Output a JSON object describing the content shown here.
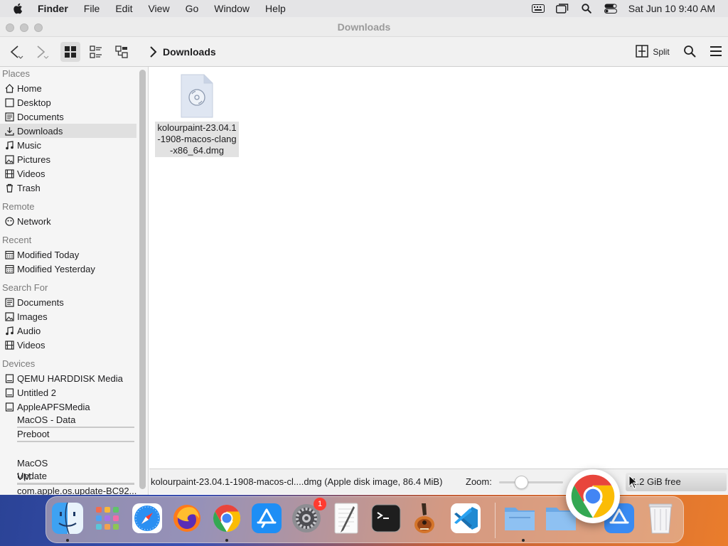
{
  "menubar": {
    "app_name": "Finder",
    "menus": [
      "File",
      "Edit",
      "View",
      "Go",
      "Window",
      "Help"
    ],
    "clock": "Sat Jun 10  9:40 AM",
    "status_icons": [
      "keyboard-icon",
      "window-icon",
      "spotlight-icon",
      "control-center-icon"
    ]
  },
  "window": {
    "title": "Downloads",
    "path": "Downloads",
    "split_label": "Split"
  },
  "sidebar": {
    "places_title": "Places",
    "places": [
      {
        "label": "Home",
        "icon": "home-icon"
      },
      {
        "label": "Desktop",
        "icon": "desktop-icon"
      },
      {
        "label": "Documents",
        "icon": "documents-icon"
      },
      {
        "label": "Downloads",
        "icon": "downloads-icon"
      },
      {
        "label": "Music",
        "icon": "music-icon"
      },
      {
        "label": "Pictures",
        "icon": "pictures-icon"
      },
      {
        "label": "Videos",
        "icon": "videos-icon"
      },
      {
        "label": "Trash",
        "icon": "trash-icon"
      }
    ],
    "remote_title": "Remote",
    "remote": [
      {
        "label": "Network",
        "icon": "network-icon"
      }
    ],
    "recent_title": "Recent",
    "recent": [
      {
        "label": "Modified Today",
        "icon": "calendar-icon"
      },
      {
        "label": "Modified Yesterday",
        "icon": "calendar-icon"
      }
    ],
    "search_title": "Search For",
    "search": [
      {
        "label": "Documents",
        "icon": "documents-icon"
      },
      {
        "label": "Images",
        "icon": "pictures-icon"
      },
      {
        "label": "Audio",
        "icon": "music-icon"
      },
      {
        "label": "Videos",
        "icon": "videos-icon"
      }
    ],
    "devices_title": "Devices",
    "devices": [
      {
        "label": "QEMU HARDDISK Media",
        "icon": "drive-icon"
      },
      {
        "label": "Untitled 2",
        "icon": "drive-icon"
      },
      {
        "label": "AppleAPFSMedia",
        "icon": "drive-icon"
      }
    ],
    "volumes": [
      {
        "label": "MacOS - Data"
      },
      {
        "label": "Preboot"
      },
      {
        "label": "MacOS\nUpdate"
      },
      {
        "label": "VM"
      },
      {
        "label": "com.apple.os.update-BC92..."
      }
    ]
  },
  "content": {
    "files": [
      {
        "name": "kolourpaint-23.04.1-1908-macos-clang-x86_64.dmg",
        "icon": "disk-image-icon"
      }
    ]
  },
  "statusbar": {
    "selection_text": "kolourpaint-23.04.1-1908-macos-cl....dmg (Apple disk image, 86.4 MiB)",
    "zoom_label": "Zoom:",
    "free_space": "(1.2 GiB free"
  },
  "dock": {
    "apps": [
      {
        "name": "finder-icon",
        "running": true
      },
      {
        "name": "launchpad-icon",
        "running": false
      },
      {
        "name": "safari-icon",
        "running": false
      },
      {
        "name": "firefox-icon",
        "running": false
      },
      {
        "name": "chrome-icon",
        "running": true
      },
      {
        "name": "app-store-icon",
        "running": false
      },
      {
        "name": "system-settings-icon",
        "running": false,
        "badge": "1"
      },
      {
        "name": "textedit-icon",
        "running": false
      },
      {
        "name": "terminal-icon",
        "running": false
      },
      {
        "name": "garageband-icon",
        "running": false
      },
      {
        "name": "vscode-icon",
        "running": false
      },
      {
        "name": "downloads-folder-icon",
        "running": true
      },
      {
        "name": "applications-folder-icon",
        "running": false
      },
      {
        "name": "trash-icon",
        "running": false
      }
    ]
  },
  "colors": {
    "selection": "#e0e0e0",
    "badge": "#ff3b30"
  }
}
